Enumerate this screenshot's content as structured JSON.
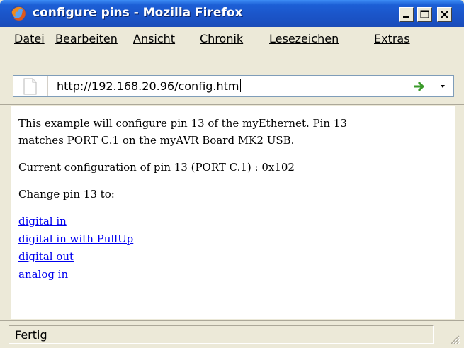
{
  "window": {
    "title": "configure pins - Mozilla Firefox",
    "icon": "firefox-icon",
    "buttons": [
      "minimize-icon",
      "maximize-icon",
      "close-icon"
    ]
  },
  "menu": {
    "items": [
      {
        "label": "Datei"
      },
      {
        "label": "Bearbeiten"
      },
      {
        "label": "Ansicht"
      },
      {
        "label": "Chronik"
      },
      {
        "label": "Lesezeichen"
      },
      {
        "label": "Extras"
      }
    ]
  },
  "address": {
    "url": "http://192.168.20.96/config.htm",
    "page_icon": "page-icon",
    "go_icon": "go-arrow-icon",
    "dropdown_icon": "dropdown-arrow-icon"
  },
  "content": {
    "intro_line1": "This example will configure pin 13 of the myEthernet. Pin 13",
    "intro_line2": "matches PORT C.1 on the myAVR Board MK2 USB.",
    "current_config": "Current configuration of pin 13 (PORT C.1) : 0x102",
    "change_label": "Change pin 13 to:",
    "links": [
      {
        "label": "digital in"
      },
      {
        "label": "digital in with PullUp"
      },
      {
        "label": "digital out"
      },
      {
        "label": "analog in"
      }
    ]
  },
  "status": {
    "text": "Fertig"
  },
  "colors": {
    "titlebar": "#1b55c9",
    "chrome": "#ece9d8",
    "link": "#0000ee",
    "go_arrow": "#3a9a2a"
  }
}
